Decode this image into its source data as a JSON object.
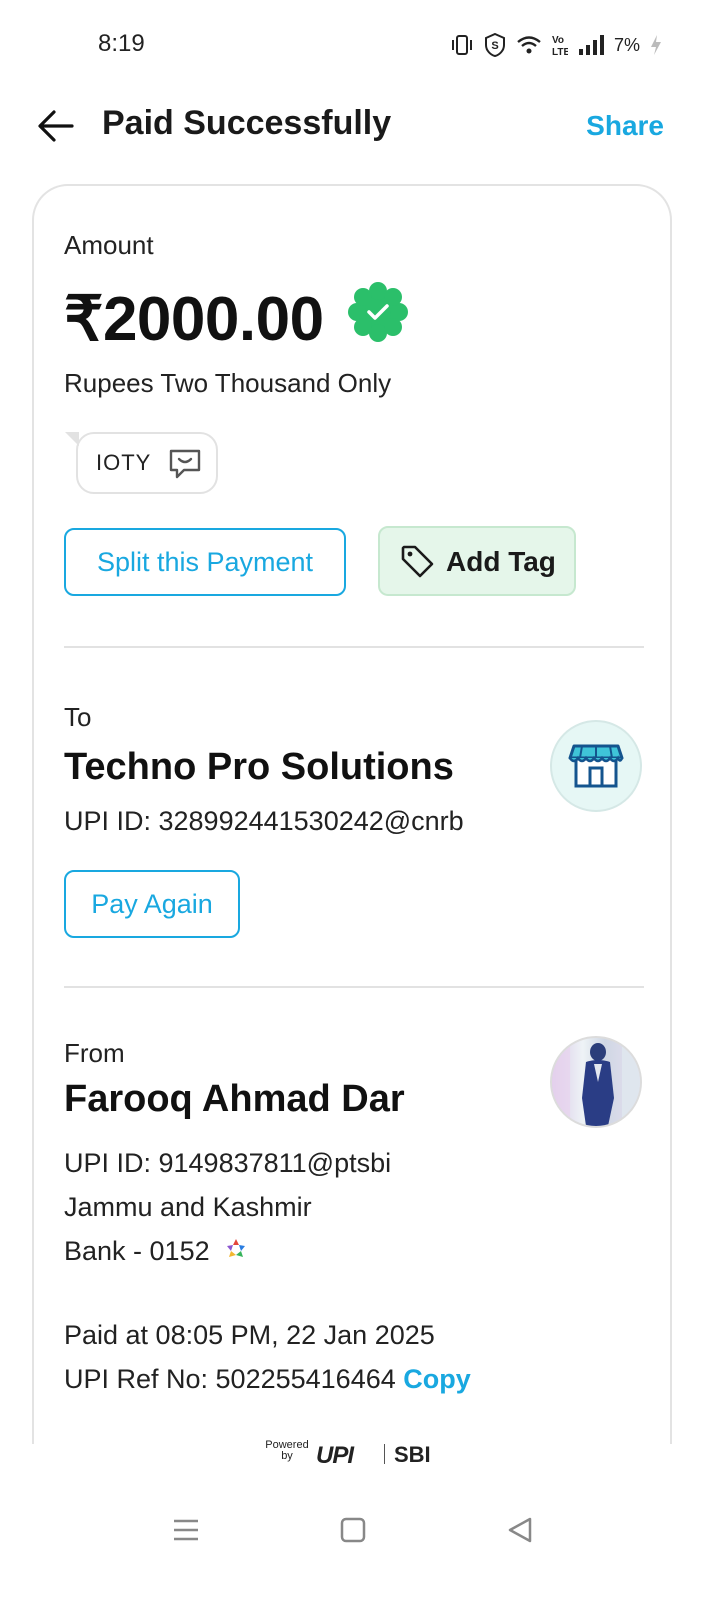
{
  "status": {
    "time": "8:19",
    "battery": "7%"
  },
  "header": {
    "title": "Paid Successfully",
    "share": "Share"
  },
  "amount": {
    "label": "Amount",
    "value": "₹2000.00",
    "words": "Rupees Two Thousand Only",
    "note": "IOTY",
    "split_label": "Split this Payment",
    "tag_label": "Add Tag"
  },
  "to": {
    "label": "To",
    "name": "Techno Pro Solutions",
    "upi": "UPI ID: 328992441530242@cnrb",
    "pay_again": "Pay Again"
  },
  "from": {
    "label": "From",
    "name": "Farooq Ahmad Dar",
    "upi": "UPI ID: 9149837811@ptsbi",
    "bank_name": "Jammu and Kashmir",
    "bank_account": "Bank - 0152"
  },
  "details": {
    "paid_at": "Paid at 08:05 PM, 22 Jan 2025",
    "ref_no": "UPI Ref No: 502255416464",
    "copy": "Copy"
  },
  "footer": {
    "powered": "Powered by",
    "upi": "UPI",
    "bank": "SBI"
  },
  "colors": {
    "accent": "#19a8e0",
    "success": "#2bbf6a",
    "tag_bg": "#e5f6ea"
  }
}
